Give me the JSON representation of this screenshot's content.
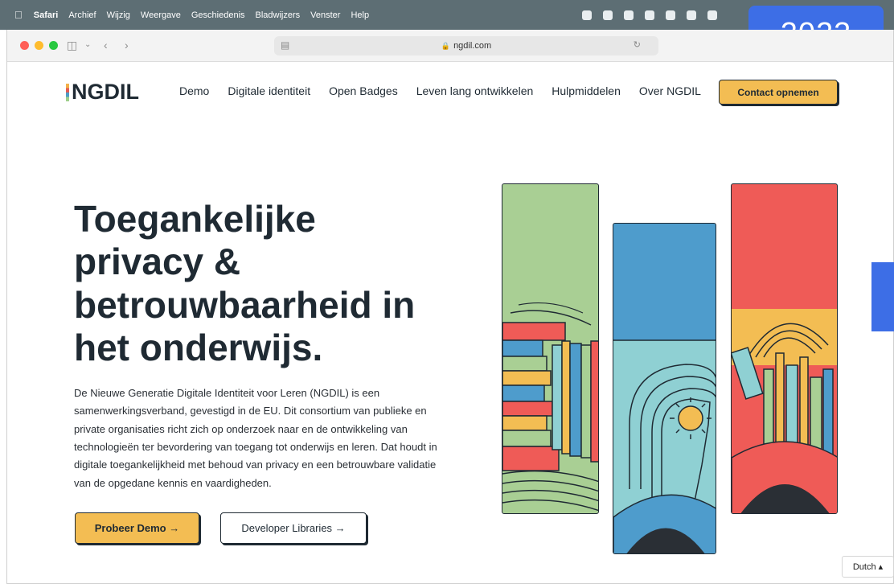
{
  "menubar": {
    "app": "Safari",
    "items": [
      "Archief",
      "Wijzig",
      "Weergave",
      "Geschiedenis",
      "Bladwijzers",
      "Venster",
      "Help"
    ]
  },
  "badge": {
    "year": "2023"
  },
  "browser": {
    "url": "ngdil.com"
  },
  "site": {
    "logo": "NGDIL",
    "nav": [
      "Demo",
      "Digitale identiteit",
      "Open Badges",
      "Leven lang ontwikkelen",
      "Hulpmiddelen",
      "Over NGDIL"
    ],
    "contact_label": "Contact opnemen"
  },
  "hero": {
    "title_lines": [
      "Toegankelijke",
      "privacy &",
      "betrouwbaarheid in",
      "het onderwijs."
    ],
    "intro": "De Nieuwe Generatie Digitale Identiteit voor Leren (NGDIL) is een samenwerkingsverband, gevestigd in de EU. Dit consortium van publieke en private organisaties richt zich op onderzoek naar en de ontwikkeling van technologieën ter bevordering van toegang tot onderwijs en leren. Dat houdt in digitale toegankelijkheid met behoud van privacy en een betrouwbare validatie van de opgedane kennis en vaardigheden.",
    "demo_label": "Probeer Demo →",
    "dev_label": "Developer Libraries →"
  },
  "language": {
    "selected": "Dutch ▴"
  },
  "colors": {
    "accent": "#f3bd53",
    "badge": "#3d6ee6",
    "dark": "#1f2a33",
    "green": "#a9cf94",
    "blue": "#4e9ccc",
    "red": "#ef5b57"
  }
}
